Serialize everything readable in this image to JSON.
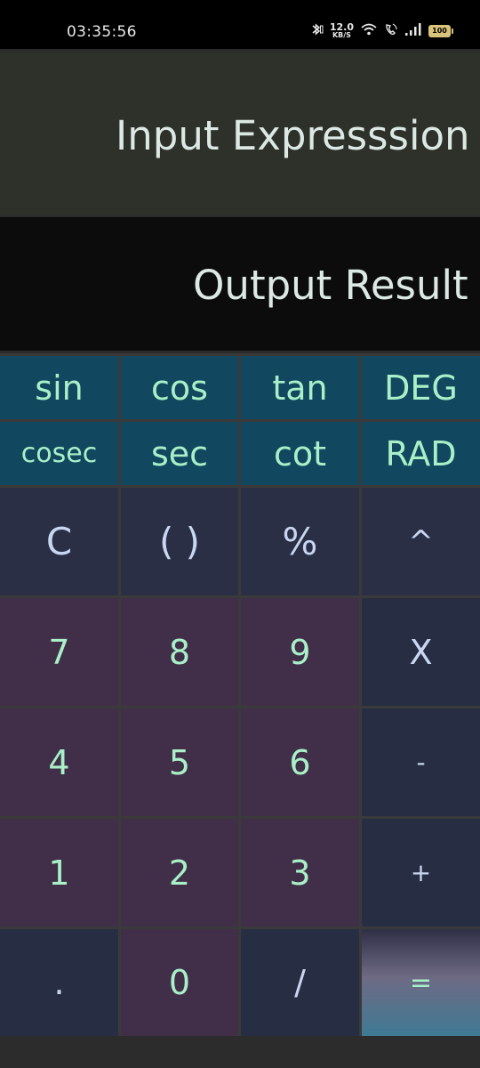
{
  "status_bar": {
    "time": "03:35:56",
    "net_speed_value": "12.0",
    "net_speed_unit": "KB/S",
    "battery": "100",
    "icons": [
      "bluetooth-icon",
      "wifi-icon",
      "call-icon",
      "signal-icon",
      "battery-icon"
    ]
  },
  "display": {
    "input_placeholder": "Input Expresssion",
    "output_placeholder": "Output Result"
  },
  "keys": {
    "row1": [
      "sin",
      "cos",
      "tan",
      "DEG"
    ],
    "row2": [
      "cosec",
      "sec",
      "cot",
      "RAD"
    ],
    "row3": [
      "C",
      "( )",
      "%",
      "^"
    ],
    "row4": [
      "7",
      "8",
      "9",
      "X"
    ],
    "row5": [
      "4",
      "5",
      "6",
      "-"
    ],
    "row6": [
      "1",
      "2",
      "3",
      "+"
    ],
    "row7": [
      ".",
      "0",
      "/",
      "="
    ]
  },
  "colors": {
    "function_key_bg": "#12485f",
    "number_key_bg": "#412f49",
    "operator_key_bg": "#272d42",
    "key_text": "#a9f0c8"
  }
}
